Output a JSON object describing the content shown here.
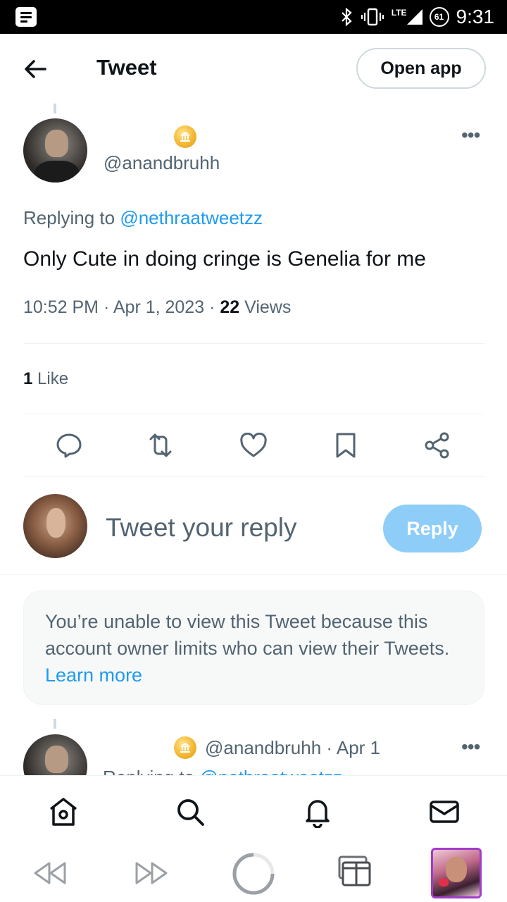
{
  "status_bar": {
    "network": "LTE",
    "battery": "61",
    "time": "9:31"
  },
  "header": {
    "title": "Tweet",
    "open_app_label": "Open app"
  },
  "tweet": {
    "handle": "@anandbruhh",
    "replying_prefix": "Replying to",
    "replying_to": "@nethraatweetzz",
    "text": "Only Cute in doing cringe is Genelia for me",
    "time": "10:52 PM",
    "date": "Apr 1, 2023",
    "views_count": "22",
    "views_label": "Views",
    "likes_count": "1",
    "likes_label": "Like"
  },
  "composer": {
    "placeholder": "Tweet your reply",
    "reply_label": "Reply"
  },
  "notice": {
    "text": "You’re unable to view this Tweet because this account owner limits who can view their Tweets.",
    "link": "Learn more"
  },
  "next_tweet": {
    "handle": "@anandbruhh",
    "date": "Apr 1",
    "replying_prefix": "Replying to",
    "replying_to": "@nethraatweetzz"
  },
  "icons": {
    "back": "arrow-left-icon",
    "more": "more-horizontal-icon",
    "coin": "government-badge-icon",
    "actions": [
      "reply-icon",
      "retweet-icon",
      "like-icon",
      "bookmark-icon",
      "share-icon"
    ],
    "nav": [
      "home-icon",
      "search-icon",
      "notifications-icon",
      "messages-icon"
    ],
    "browser": [
      "back-icon",
      "forward-icon",
      "reload-icon",
      "tabs-icon"
    ]
  },
  "colors": {
    "accent": "#1d9bf0",
    "reply_button_disabled": "#8ecdf8",
    "secondary_text": "#536471",
    "primary_text": "#0f1419"
  }
}
